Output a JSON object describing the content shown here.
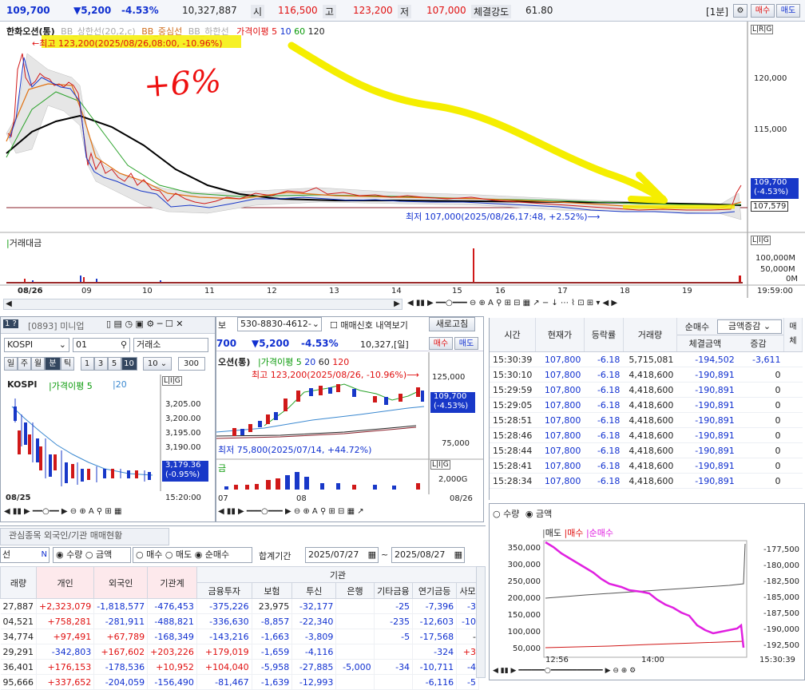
{
  "topbar": {
    "price": "109,700",
    "change": "▼5,200",
    "change_pct": "-4.53%",
    "volume": "10,327,887",
    "open_label": "시",
    "open": "116,500",
    "high_label": "고",
    "high": "123,200",
    "low_label": "저",
    "low": "107,000",
    "strength_label": "체결강도",
    "strength": "61.80",
    "period": "[1분]",
    "buy": "매수",
    "sell": "매도"
  },
  "main_chart": {
    "stock_name": "한화오션(통)",
    "legend_bb_upper": "BB_상한선(20,2,c)",
    "legend_bb_mid": "BB_중심선",
    "legend_bb_lower": "BB_하한선",
    "legend_ma": "가격이평",
    "ma_periods": [
      "5",
      "10",
      "60",
      "120"
    ],
    "high_annotation": "최고 123,200(2025/08/26,08:00, -10.96%)",
    "low_annotation": "최저 107,000(2025/08/26,17:48, +2.52%)",
    "handwritten": "+6%",
    "y_ticks": [
      "120,000",
      "115,000"
    ],
    "last_price_tag": "109,700",
    "last_pct_tag": "(-4.53%)",
    "ref_price_tag": "107,579",
    "volume_title": "거래대금",
    "vol_ticks": [
      "100,000M",
      "50,000M",
      "0M"
    ],
    "x_ticks": [
      "08/26",
      "09",
      "10",
      "11",
      "12",
      "13",
      "14",
      "15",
      "16",
      "17",
      "18",
      "19"
    ],
    "time_label": "19:59:00"
  },
  "chart_data": {
    "type": "line",
    "x": [
      "08:00",
      "09",
      "10",
      "11",
      "12",
      "13",
      "14",
      "15",
      "16",
      "17",
      "18",
      "19",
      "19:59"
    ],
    "series": [
      {
        "name": "",
        "values": [
          110500,
          118500,
          109800,
          108400,
          108800,
          109300,
          108600,
          108500,
          108200,
          108100,
          107600,
          107400,
          109700
        ]
      }
    ],
    "ylabel": "",
    "ylim": [
      106000,
      125000
    ]
  },
  "mini_panel": {
    "window_id": "[0893] 미니업",
    "index_name": "KOSPI",
    "code": "01",
    "market": "거래소",
    "timeframes": [
      "일",
      "주",
      "월",
      "분",
      "틱",
      "1",
      "3",
      "5",
      "10"
    ],
    "count_select": "10",
    "count_value": "300",
    "chart_title": "KOSPI",
    "ma_label": "가격이평 5",
    "ma2": "20",
    "y_ticks": [
      "3,205.00",
      "3,200.00",
      "3,195.00",
      "3,190.00"
    ],
    "last_tag": "3,179.36",
    "last_pct": "(-0.95%)",
    "date": "08/25",
    "time": "15:20:00"
  },
  "mid_panel": {
    "account_label": "보",
    "account": "530-8830-4612-",
    "signal_label": "매매신호 내역보기",
    "refresh": "새로고침",
    "price": "700",
    "change": "▼5,200",
    "pct": "-4.53%",
    "volume": "10,327,[일]",
    "buy": "매수",
    "sell": "매도",
    "stock_name": "오션(통)",
    "ma_label": "가격이평 5",
    "ma_periods": [
      "20",
      "60",
      "120"
    ],
    "high_annotation": "최고 123,200(2025/08/26, -10.96%)",
    "low_annotation": "최저 75,800(2025/07/14, +44.72%)",
    "y_ticks": [
      "125,000",
      "75,000"
    ],
    "vol_tick": "2,000G",
    "last_tag": "109,700",
    "last_pct": "(-4.53%)",
    "vol_label": "금",
    "x_labels": [
      "07",
      "08",
      "08/26"
    ]
  },
  "trade_table": {
    "headers": [
      "시간",
      "현재가",
      "등락률",
      "거래량",
      "순매수",
      "금액증감",
      "매"
    ],
    "subheaders": [
      "체결금액",
      "증감",
      "체"
    ],
    "rows": [
      [
        "15:30:39",
        "107,800",
        "-6.18",
        "5,715,081",
        "-194,502",
        "-3,611"
      ],
      [
        "15:30:10",
        "107,800",
        "-6.18",
        "4,418,600",
        "-190,891",
        "0"
      ],
      [
        "15:29:59",
        "107,800",
        "-6.18",
        "4,418,600",
        "-190,891",
        "0"
      ],
      [
        "15:29:05",
        "107,800",
        "-6.18",
        "4,418,600",
        "-190,891",
        "0"
      ],
      [
        "15:28:51",
        "107,800",
        "-6.18",
        "4,418,600",
        "-190,891",
        "0"
      ],
      [
        "15:28:46",
        "107,800",
        "-6.18",
        "4,418,600",
        "-190,891",
        "0"
      ],
      [
        "15:28:44",
        "107,800",
        "-6.18",
        "4,418,600",
        "-190,891",
        "0"
      ],
      [
        "15:28:41",
        "107,800",
        "-6.18",
        "4,418,600",
        "-190,891",
        "0"
      ],
      [
        "15:28:34",
        "107,800",
        "-6.18",
        "4,418,600",
        "-190,891",
        "0"
      ]
    ]
  },
  "flow_chart": {
    "radio_qty": "수량",
    "radio_amt": "금액",
    "legend": [
      "매도",
      "매수",
      "순매수"
    ],
    "left_ticks": [
      "350,000",
      "300,000",
      "250,000",
      "200,000",
      "150,000",
      "100,000",
      "50,000"
    ],
    "right_ticks": [
      "-177,500",
      "-180,000",
      "-182,500",
      "-185,000",
      "-187,500",
      "-190,000",
      "-192,500"
    ],
    "x_ticks": [
      "12:56",
      "14:00",
      "15:30:39"
    ]
  },
  "investor": {
    "tabs": [
      "관심종목 외국인/기관 매매현황"
    ],
    "search_value": "선",
    "radios": [
      "수량",
      "금액",
      "매수",
      "매도",
      "순매수"
    ],
    "period_label": "합계기간",
    "date_from": "2025/07/27",
    "date_to": "2025/08/27",
    "group_header": "기관",
    "headers": [
      "래량",
      "개인",
      "외국인",
      "기관계",
      "금융투자",
      "보험",
      "투신",
      "은행",
      "기타금융",
      "연기금등",
      "사모"
    ],
    "rows": [
      [
        "27,887",
        "+2,323,079",
        "-1,818,577",
        "-476,453",
        "-375,226",
        "23,975",
        "-32,177",
        "",
        "-25",
        "-7,396",
        "-3"
      ],
      [
        "04,521",
        "+758,281",
        "-281,911",
        "-488,821",
        "-336,630",
        "-8,857",
        "-22,340",
        "",
        "-235",
        "-12,603",
        "-10"
      ],
      [
        "34,774",
        "+97,491",
        "+67,789",
        "-168,349",
        "-143,216",
        "-1,663",
        "-3,809",
        "",
        "-5",
        "-17,568",
        "-"
      ],
      [
        "29,291",
        "-342,803",
        "+167,602",
        "+203,226",
        "+179,019",
        "-1,659",
        "-4,116",
        "",
        "",
        "-324",
        "+3"
      ],
      [
        "36,401",
        "+176,153",
        "-178,536",
        "+10,952",
        "+104,040",
        "-5,958",
        "-27,885",
        "-5,000",
        "-34",
        "-10,711",
        "-4"
      ],
      [
        "95,666",
        "+337,652",
        "-204,059",
        "-156,490",
        "-81,467",
        "-1,639",
        "-12,993",
        "",
        "",
        "-6,116",
        "-5"
      ]
    ]
  },
  "colors": {
    "up": "#e01010",
    "down": "#1030d0",
    "highlight": "#f5ee00",
    "magenta": "#e020e0"
  }
}
